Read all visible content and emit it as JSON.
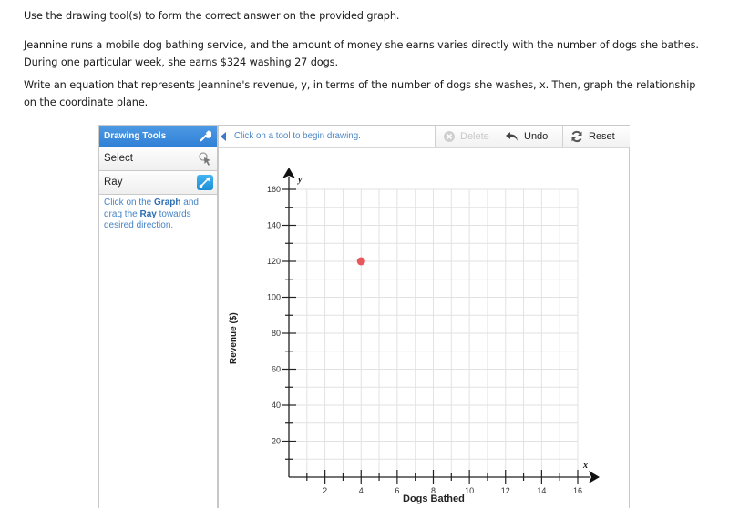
{
  "instructions": {
    "line1": "Use the drawing tool(s) to form the correct answer on the provided graph.",
    "line2": "Jeannine runs a mobile dog bathing service, and the amount of money she earns varies directly with the number of dogs she bathes. During one particular week, she earns $324 washing 27 dogs.",
    "line3": "Write an equation that represents Jeannine's revenue, y, in terms of the number of dogs she washes, x. Then, graph the relationship on the coordinate plane."
  },
  "sidebar": {
    "header": "Drawing Tools",
    "header_icon": "wrench-icon",
    "tools": [
      {
        "label": "Select",
        "icon": "cursor-pointer-icon"
      },
      {
        "label": "Ray",
        "icon": "ray-icon",
        "selected": true
      }
    ],
    "help": {
      "part1": "Click on the ",
      "bold1": "Graph",
      "part2": " and drag the ",
      "bold2": "Ray",
      "part3": " towards desired direction."
    },
    "accent": "#3a8ae0"
  },
  "toolbar": {
    "hint": "Click on a tool to begin drawing.",
    "delete_label": "Delete",
    "undo_label": "Undo",
    "reset_label": "Reset",
    "delete_enabled": false
  },
  "chart_data": {
    "type": "scatter",
    "title": "",
    "xlabel": "Dogs Bathed",
    "ylabel": "Revenue ($)",
    "x_axis_name": "x",
    "y_axis_name": "y",
    "xlim": [
      0,
      16
    ],
    "ylim": [
      0,
      160
    ],
    "x_ticks": [
      2,
      4,
      6,
      8,
      10,
      12,
      14,
      16
    ],
    "y_ticks": [
      20,
      40,
      60,
      80,
      100,
      120,
      140,
      160
    ],
    "x_minor_step": 1,
    "y_minor_step": 10,
    "grid": true,
    "points": [
      {
        "x": 4,
        "y": 120
      }
    ],
    "point_color": "#e8575a"
  }
}
